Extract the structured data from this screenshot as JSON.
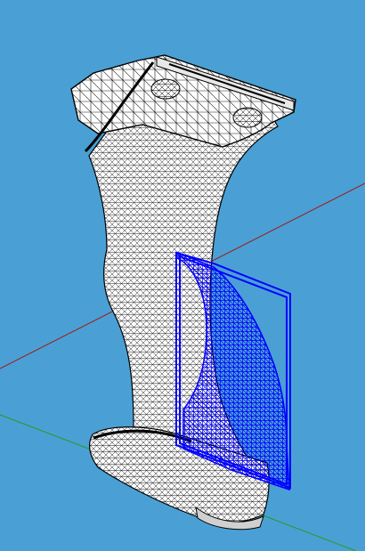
{
  "viewport": {
    "background": "#4aa0d4",
    "model": {
      "kind": "wireframe-mesh",
      "fill": "#ffffff",
      "stroke": "#000000"
    },
    "selection": {
      "kind": "highlighted-mesh-patch",
      "color": "#0000ff"
    },
    "axes": [
      {
        "name": "x-axis",
        "color": "#a01818"
      },
      {
        "name": "y-axis",
        "color": "#1e9e1e"
      }
    ]
  }
}
